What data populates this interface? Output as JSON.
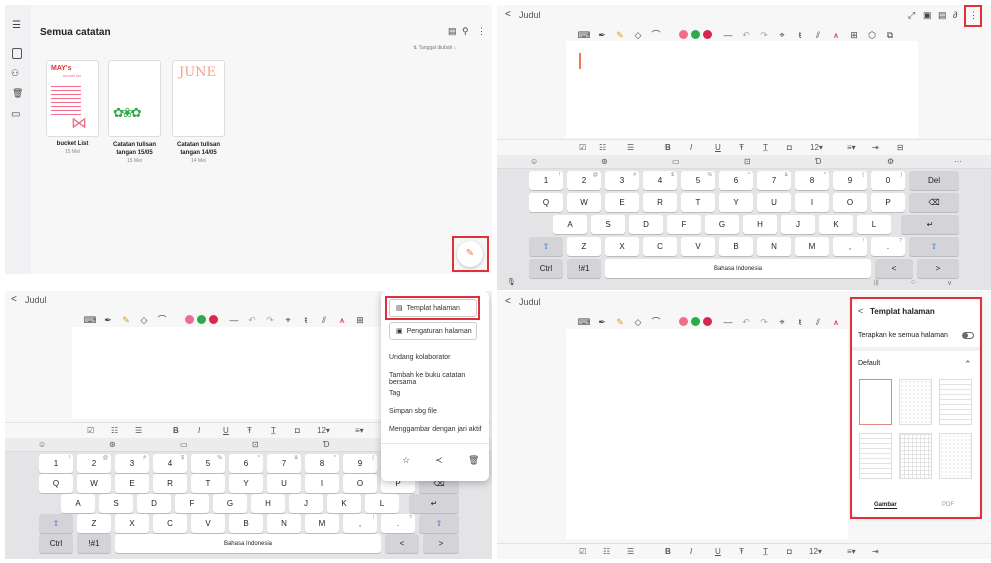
{
  "colors": {
    "accent_red": "#e0313a",
    "orange": "#f07a4a",
    "pink": "#f06e8c",
    "green": "#2faa4a",
    "magenta": "#d9274c",
    "blue": "#2f6bd9"
  },
  "q1": {
    "title": "Semua catatan",
    "sort_label": "Tanggal diubah",
    "notes": [
      {
        "title": "bucket List",
        "date": "15 Mei",
        "cover_text": "MAY's",
        "cover_sub": "bucket list"
      },
      {
        "title": "Catatan tulisan tangan 15/05",
        "date": "15 Mei"
      },
      {
        "title": "Catatan tulisan tangan 14/05",
        "date": "14 Mei",
        "cover_text": "JUNE"
      }
    ],
    "icons": {
      "menu": "menu-icon",
      "notes": "notes-icon",
      "shared": "shared-icon",
      "trash": "trash-icon",
      "folder": "folder-icon",
      "pdf": "pdf-icon",
      "search": "search-icon",
      "more": "more-icon",
      "compose": "compose-icon"
    }
  },
  "title": "Judul",
  "keyboard": {
    "numbers": [
      {
        "k": "1",
        "s": "!"
      },
      {
        "k": "2",
        "s": "@"
      },
      {
        "k": "3",
        "s": "#"
      },
      {
        "k": "4",
        "s": "$"
      },
      {
        "k": "5",
        "s": "%"
      },
      {
        "k": "6",
        "s": "^"
      },
      {
        "k": "7",
        "s": "&"
      },
      {
        "k": "8",
        "s": "*"
      },
      {
        "k": "9",
        "s": "("
      },
      {
        "k": "0",
        "s": ")"
      }
    ],
    "row1": [
      "Q",
      "W",
      "E",
      "R",
      "T",
      "Y",
      "U",
      "I",
      "O",
      "P"
    ],
    "row2": [
      "A",
      "S",
      "D",
      "F",
      "G",
      "H",
      "J",
      "K",
      "L"
    ],
    "row3": [
      "Z",
      "X",
      "C",
      "V",
      "B",
      "N",
      "M",
      ",",
      "."
    ],
    "row3_sup": [
      "",
      "",
      "",
      "",
      "",
      "",
      "",
      "!",
      "?"
    ],
    "del": "Del",
    "ctrl": "Ctrl",
    "sym": "!#1",
    "space": "Bahasa Indonesia",
    "left": "<",
    "right": ">",
    "nav_back": "|||",
    "nav_home": "○",
    "nav_down": "∨"
  },
  "format_bar": [
    "B",
    "I",
    "U",
    "Ŧ",
    "T̲",
    "12▾",
    "≡▾"
  ],
  "menu": {
    "template": "Templat halaman",
    "page_settings": "Pengaturan halaman",
    "items": [
      "Undang kolaborator",
      "Tambah ke buku catatan bersama",
      "Tag",
      "Simpan sbg file",
      "Menggambar dengan jari aktif"
    ]
  },
  "template_panel": {
    "title": "Templat halaman",
    "apply_all": "Terapkan ke semua halaman",
    "section": "Default",
    "tabs": [
      "Gambar",
      "PDF"
    ]
  }
}
